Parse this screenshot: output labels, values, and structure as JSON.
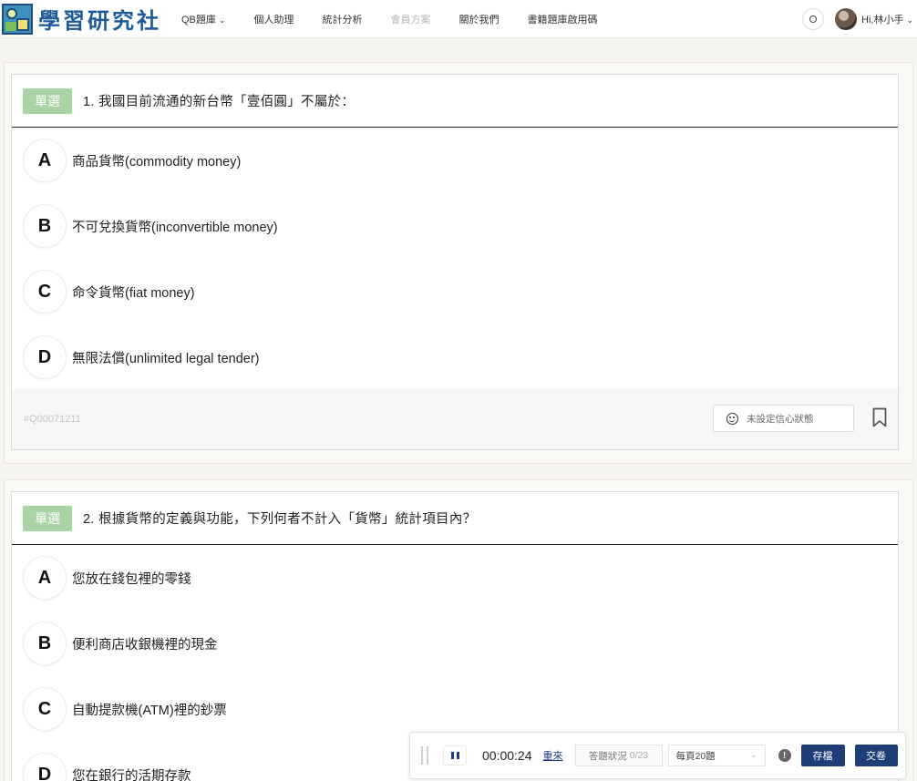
{
  "nav": {
    "logo_text": "學習研究社",
    "items": [
      {
        "label": "QB題庫",
        "caret": "⌄"
      },
      {
        "label": "個人助理"
      },
      {
        "label": "統計分析"
      },
      {
        "label": "會員方案"
      },
      {
        "label": "關於我們"
      },
      {
        "label": "書籍題庫啟用碼"
      }
    ],
    "user": {
      "name": "Hi,林小手",
      "caret": "⌄"
    }
  },
  "questions": [
    {
      "type_badge": "單選",
      "text": "1. 我國目前流通的新台幣「壹佰圓」不屬於：",
      "options": [
        {
          "letter": "A",
          "text": "商品貨幣(commodity money)"
        },
        {
          "letter": "B",
          "text": "不可兌換貨幣(inconvertible money)"
        },
        {
          "letter": "C",
          "text": "命令貨幣(fiat money)"
        },
        {
          "letter": "D",
          "text": "無限法償(unlimited legal tender)"
        }
      ],
      "id": "#Q00071211",
      "confidence_label": "未設定信心狀態"
    },
    {
      "type_badge": "單選",
      "text": "2. 根據貨幣的定義與功能，下列何者不計入「貨幣」統計項目內？",
      "options": [
        {
          "letter": "A",
          "text": "您放在錢包裡的零錢"
        },
        {
          "letter": "B",
          "text": "便利商店收銀機裡的現金"
        },
        {
          "letter": "C",
          "text": "自動提款機(ATM)裡的鈔票"
        },
        {
          "letter": "D",
          "text": "您在銀行的活期存款"
        }
      ]
    }
  ],
  "toolbar": {
    "timer": "00:00:24",
    "restart": "重來",
    "status_label": "答題狀況",
    "status_count": "0/23",
    "per_page": "每頁20題",
    "info": "!",
    "save": "存檔",
    "submit": "交卷"
  },
  "colors": {
    "badge": "#a8d4a6",
    "primary": "#1e3e78",
    "logo": "#1e5a9a"
  }
}
